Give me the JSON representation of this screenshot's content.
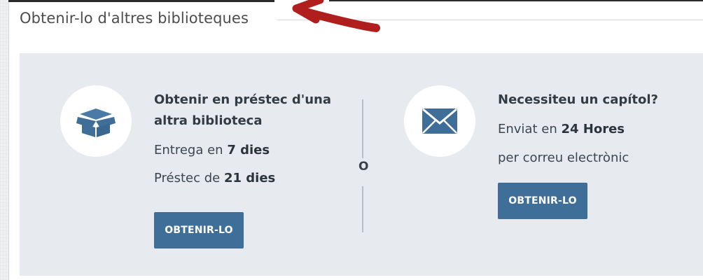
{
  "section": {
    "title": "Obtenir-lo d'altres biblioteques"
  },
  "loan_option": {
    "icon": "box-icon",
    "title_line1": "Obtenir en préstec d'una",
    "title_line2": "altra biblioteca",
    "delivery_prefix": "Entrega en ",
    "delivery_value": "7 dies",
    "loan_prefix": "Préstec de ",
    "loan_value": "21 dies",
    "button_label": "OBTENIR-LO"
  },
  "separator": {
    "label": "O"
  },
  "chapter_option": {
    "icon": "envelope-icon",
    "title": "Necessiteu un capítol?",
    "sent_prefix": "Enviat en ",
    "sent_value": "24 Hores",
    "via_text": "per correu electrònic",
    "button_label": "OBTENIR-LO"
  },
  "colors": {
    "accent": "#3f6e98",
    "card_bg": "#e7ebef",
    "annotation_arrow": "#b11e1e"
  }
}
